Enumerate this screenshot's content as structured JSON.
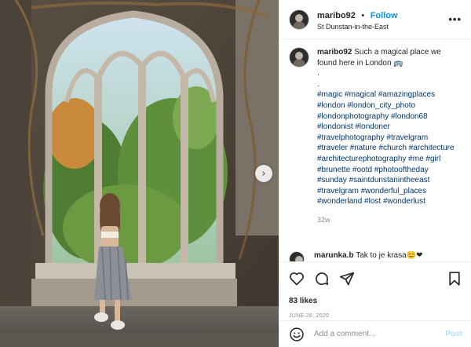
{
  "post": {
    "username": "maribo92",
    "dot": "•",
    "follow_label": "Follow",
    "location": "St Dunstan-in-the-East",
    "more": "•••"
  },
  "caption": {
    "username": "maribo92",
    "text": "Such a magical place we found here in London 🚌",
    "dots": [
      ".",
      "."
    ],
    "hashtags": "#magic #magical #amazingplaces #london #london_city_photo #londonphotography #london68 #londonist #londoner #travelphotography #travelgram #traveler #nature #church #architecture #architecturephotography #me #girl #brunette #ootd #photooftheday #sunday #saintdunstanintheeast #travelgram #wonderful_places #wonderland #lost #wonderlust",
    "time": "32w"
  },
  "comment": {
    "username": "marunka.b",
    "text": "Tak to je krasa😊❤"
  },
  "engagement": {
    "likes": "83 likes",
    "date": "JUNE 28, 2020"
  },
  "add_comment": {
    "placeholder": "Add a comment...",
    "post_label": "Post"
  },
  "icons": {
    "carousel_next": "chevron-right-icon",
    "like": "heart-icon",
    "comment": "comment-icon",
    "share": "share-icon",
    "save": "bookmark-icon",
    "emoji": "smiley-icon"
  },
  "colors": {
    "link_blue": "#0095f6",
    "hashtag": "#00376b",
    "muted": "#8e8e8e",
    "post_disabled": "#b2dffc"
  }
}
